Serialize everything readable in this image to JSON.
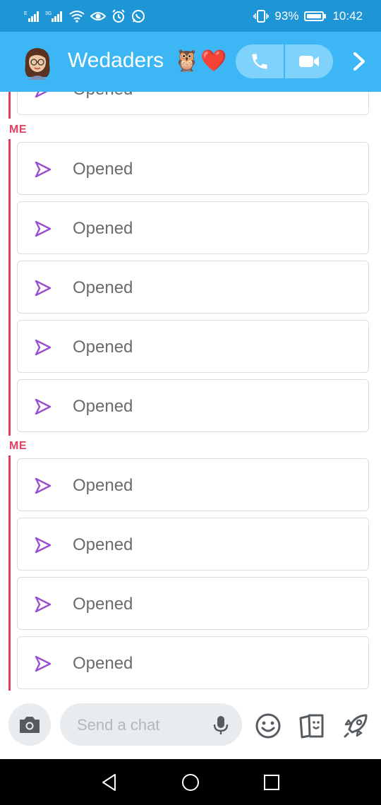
{
  "status_bar": {
    "battery_percent": "93%",
    "time": "10:42",
    "network_label": "3G",
    "left_icons": [
      "signal-icon",
      "signal-icon",
      "wifi-icon",
      "eye-icon",
      "alarm-icon",
      "whatsapp-icon"
    ],
    "right_icons": [
      "vibrate-icon",
      "battery-icon"
    ]
  },
  "header": {
    "contact_name": "Wedaders",
    "name_emojis": [
      "🦉",
      "❤️"
    ],
    "icons": [
      "avatar",
      "phone-icon",
      "video-icon",
      "chevron-right-icon"
    ],
    "background_color": "#3db6f5"
  },
  "chat": {
    "accent_color": "#e0405e",
    "arrow_color": "#9b4fd0",
    "groups": [
      {
        "sender": "",
        "messages": [
          {
            "status": "Opened"
          }
        ]
      },
      {
        "sender": "ME",
        "messages": [
          {
            "status": "Opened"
          },
          {
            "status": "Opened"
          },
          {
            "status": "Opened"
          },
          {
            "status": "Opened"
          },
          {
            "status": "Opened"
          }
        ]
      },
      {
        "sender": "ME",
        "messages": [
          {
            "status": "Opened"
          },
          {
            "status": "Opened"
          },
          {
            "status": "Opened"
          },
          {
            "status": "Opened"
          }
        ]
      }
    ]
  },
  "input_bar": {
    "placeholder": "Send a chat",
    "icons": [
      "camera-icon",
      "microphone-icon",
      "emoji-icon",
      "stickers-icon",
      "rocket-icon"
    ]
  },
  "nav_bar": {
    "icons": [
      "back-icon",
      "home-icon",
      "recents-icon"
    ]
  }
}
